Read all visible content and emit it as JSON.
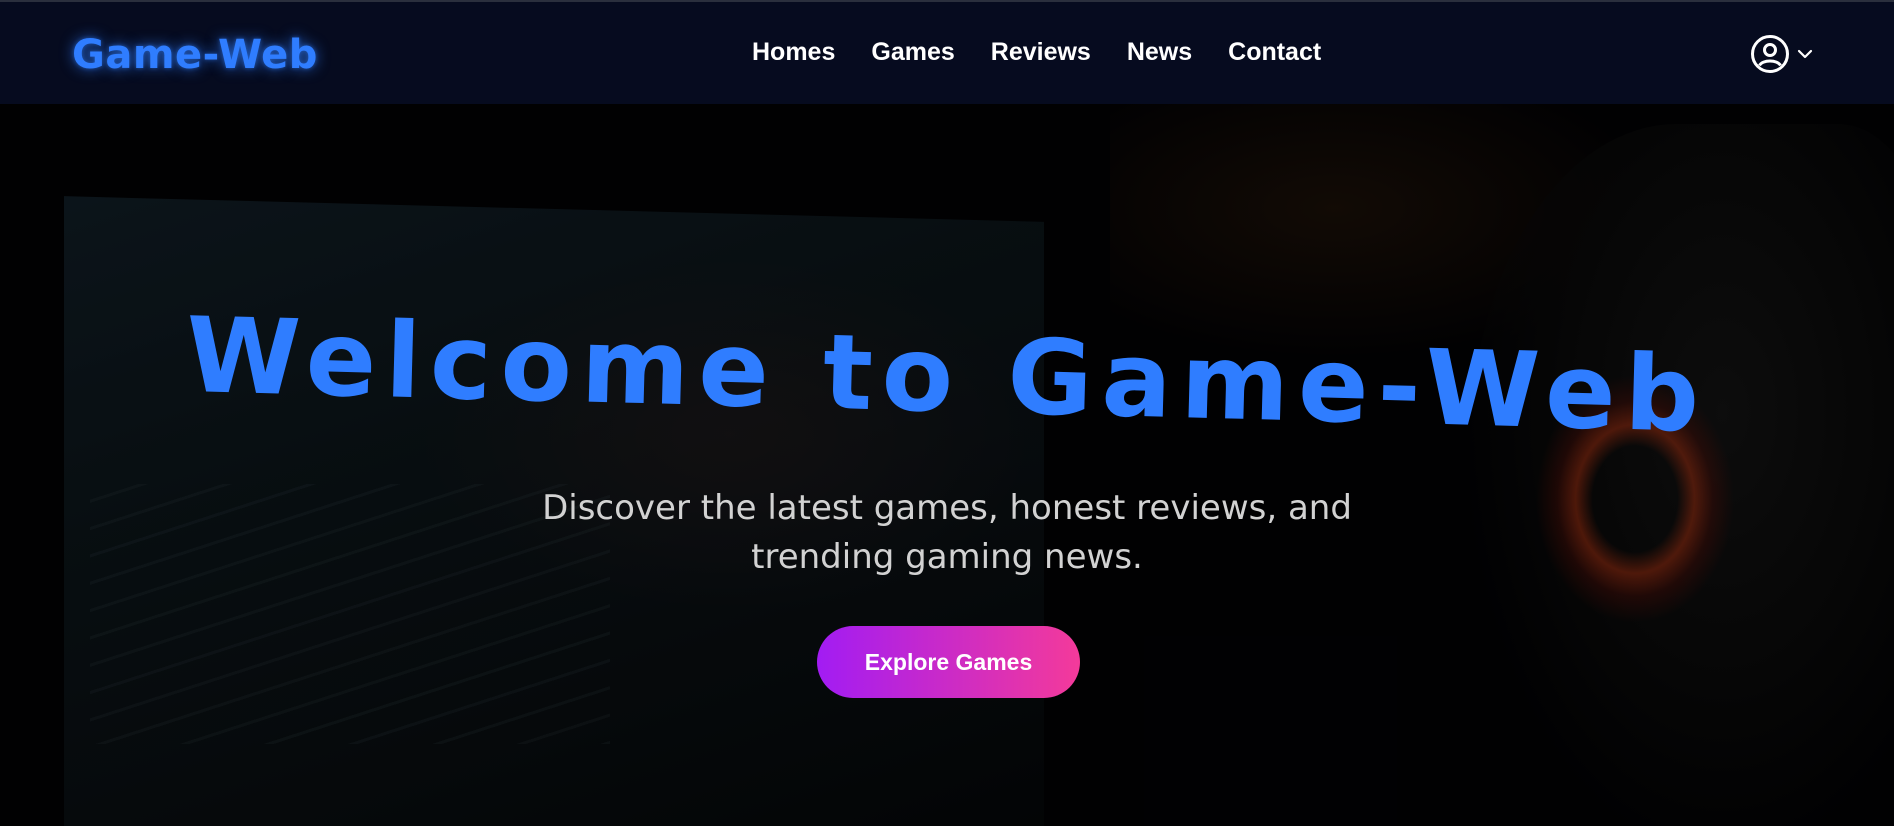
{
  "header": {
    "logo": "Game-Web",
    "nav": [
      "Homes",
      "Games",
      "Reviews",
      "News",
      "Contact"
    ],
    "account_icon": "user-circle-icon",
    "dropdown_icon": "chevron-down-icon"
  },
  "hero": {
    "title": "Welcome to Game-Web",
    "subtitle": "Discover the latest games, honest reviews, and trending gaming news.",
    "cta_label": "Explore Games",
    "background_image": "dark gaming setup photo (monitor on left, person with glowing headphones on right)"
  },
  "colors": {
    "accent_blue": "#2f7dff",
    "header_bg": "#060b1f",
    "cta_gradient_start": "#a21cf3",
    "cta_gradient_end": "#f43a9a",
    "subtitle_text": "#d2d2d2"
  }
}
